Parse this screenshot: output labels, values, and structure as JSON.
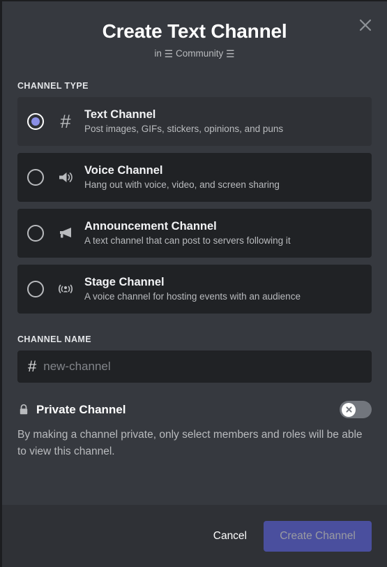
{
  "dialog": {
    "title": "Create Text Channel",
    "subtitle_prefix": "in",
    "subtitle_glyph_left": "☰",
    "subtitle_server": "Community",
    "subtitle_glyph_right": "☰",
    "close_icon": "close-icon"
  },
  "channel_type": {
    "label": "CHANNEL TYPE",
    "options": [
      {
        "id": "text",
        "title": "Text Channel",
        "description": "Post images, GIFs, stickers, opinions, and puns",
        "icon": "hash-icon",
        "selected": true
      },
      {
        "id": "voice",
        "title": "Voice Channel",
        "description": "Hang out with voice, video, and screen sharing",
        "icon": "speaker-icon",
        "selected": false
      },
      {
        "id": "announcement",
        "title": "Announcement Channel",
        "description": "A text channel that can post to servers following it",
        "icon": "megaphone-icon",
        "selected": false
      },
      {
        "id": "stage",
        "title": "Stage Channel",
        "description": "A voice channel for hosting events with an audience",
        "icon": "stage-broadcast-icon",
        "selected": false
      }
    ]
  },
  "channel_name": {
    "label": "CHANNEL NAME",
    "prefix": "#",
    "value": "",
    "placeholder": "new-channel"
  },
  "private_channel": {
    "title": "Private Channel",
    "lock_icon": "lock-icon",
    "toggle_state": "off",
    "toggle_knob_icon": "cross-icon",
    "description": "By making a channel private, only select members and roles will be able to view this channel."
  },
  "footer": {
    "cancel_label": "Cancel",
    "create_label": "Create Channel",
    "create_enabled": false
  },
  "colors": {
    "modal_bg": "#36393f",
    "card_bg": "#202225",
    "card_selected_bg": "#2f3136",
    "footer_bg": "#2f3136",
    "accent": "#8b8fe6",
    "primary_button": "#4a4f9e",
    "text_primary": "#ffffff",
    "text_muted": "#b9bbbe"
  }
}
